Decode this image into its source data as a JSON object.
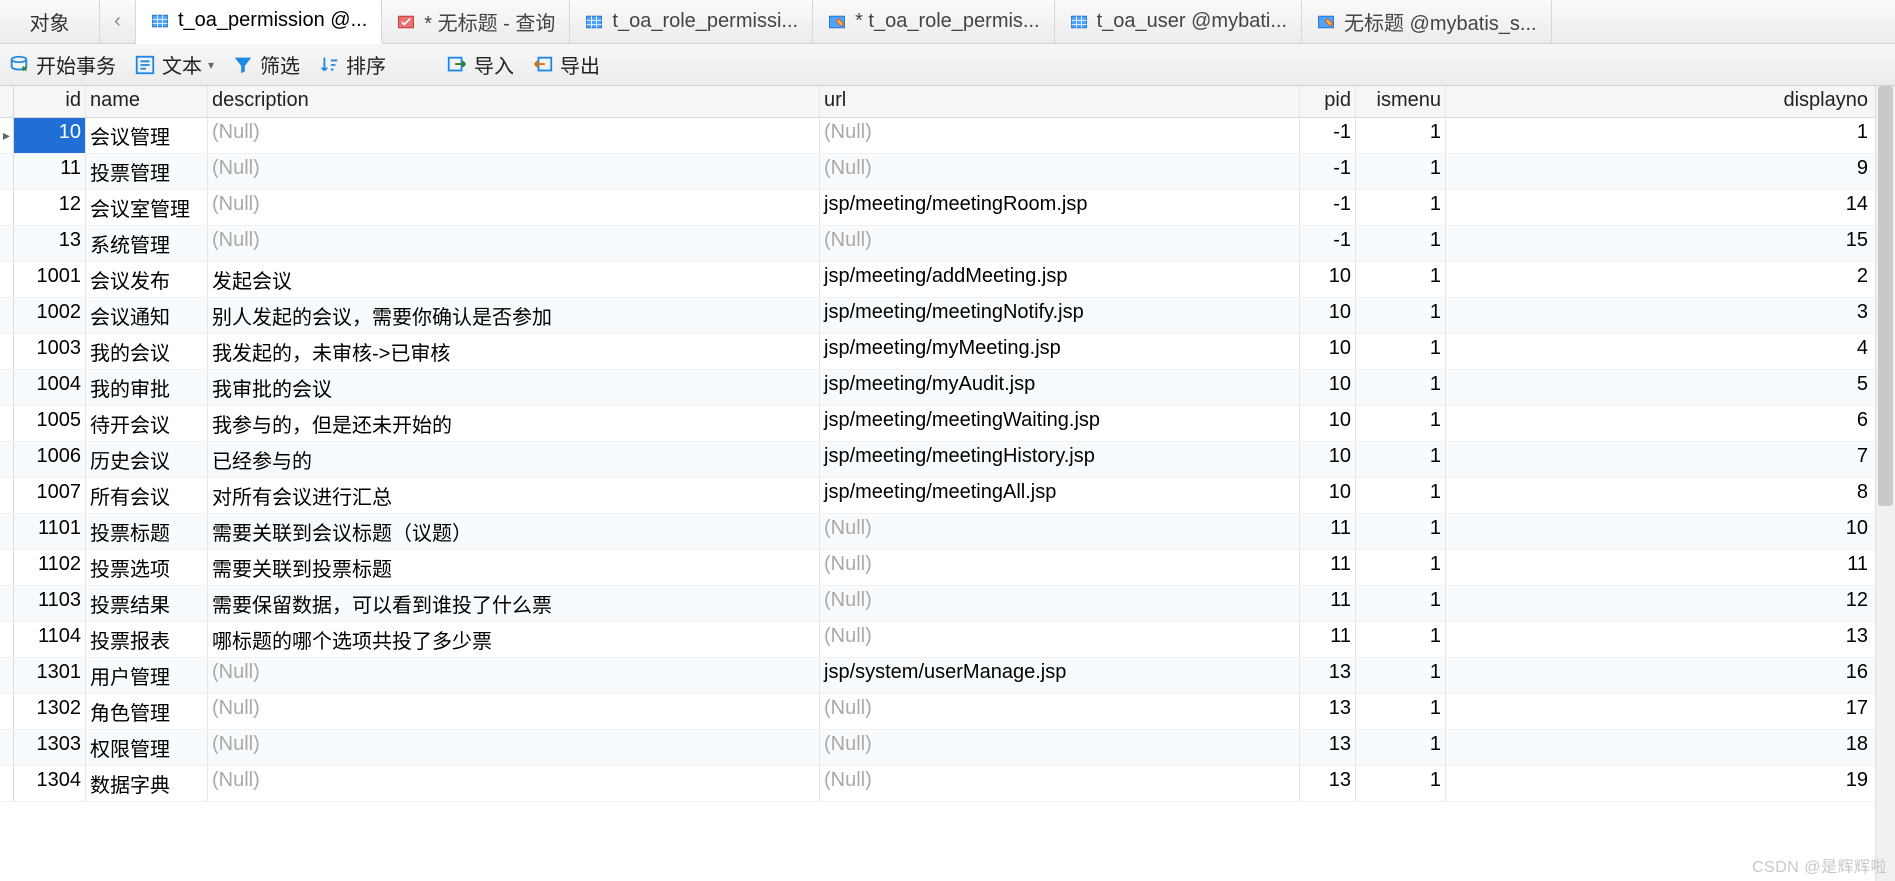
{
  "tabbar": {
    "object_label": "对象",
    "nav_prev": "‹",
    "tabs": [
      {
        "label": "t_oa_permission @...",
        "icon": "table",
        "active": true
      },
      {
        "label": "* 无标题 - 查询",
        "icon": "query",
        "active": false
      },
      {
        "label": "t_oa_role_permissi...",
        "icon": "table",
        "active": false
      },
      {
        "label": "* t_oa_role_permis...",
        "icon": "design",
        "active": false
      },
      {
        "label": "t_oa_user @mybati...",
        "icon": "table",
        "active": false
      },
      {
        "label": "无标题 @mybatis_s...",
        "icon": "design",
        "active": false
      }
    ]
  },
  "toolbar": {
    "begin_tx": "开始事务",
    "text": "文本",
    "filter": "筛选",
    "sort": "排序",
    "import": "导入",
    "export": "导出"
  },
  "columns": {
    "id": "id",
    "name": "name",
    "description": "description",
    "url": "url",
    "pid": "pid",
    "ismenu": "ismenu",
    "displayno": "displayno"
  },
  "null_label": "(Null)",
  "rows": [
    {
      "id": 10,
      "name": "会议管理",
      "description": null,
      "url": null,
      "pid": -1,
      "ismenu": 1,
      "displayno": 1,
      "selected": true
    },
    {
      "id": 11,
      "name": "投票管理",
      "description": null,
      "url": null,
      "pid": -1,
      "ismenu": 1,
      "displayno": 9
    },
    {
      "id": 12,
      "name": "会议室管理",
      "description": null,
      "url": "jsp/meeting/meetingRoom.jsp",
      "pid": -1,
      "ismenu": 1,
      "displayno": 14
    },
    {
      "id": 13,
      "name": "系统管理",
      "description": null,
      "url": null,
      "pid": -1,
      "ismenu": 1,
      "displayno": 15
    },
    {
      "id": 1001,
      "name": "会议发布",
      "description": "发起会议",
      "url": "jsp/meeting/addMeeting.jsp",
      "pid": 10,
      "ismenu": 1,
      "displayno": 2
    },
    {
      "id": 1002,
      "name": "会议通知",
      "description": "别人发起的会议，需要你确认是否参加",
      "url": "jsp/meeting/meetingNotify.jsp",
      "pid": 10,
      "ismenu": 1,
      "displayno": 3
    },
    {
      "id": 1003,
      "name": "我的会议",
      "description": "我发起的，未审核->已审核",
      "url": "jsp/meeting/myMeeting.jsp",
      "pid": 10,
      "ismenu": 1,
      "displayno": 4
    },
    {
      "id": 1004,
      "name": "我的审批",
      "description": "我审批的会议",
      "url": "jsp/meeting/myAudit.jsp",
      "pid": 10,
      "ismenu": 1,
      "displayno": 5
    },
    {
      "id": 1005,
      "name": "待开会议",
      "description": "我参与的，但是还未开始的",
      "url": "jsp/meeting/meetingWaiting.jsp",
      "pid": 10,
      "ismenu": 1,
      "displayno": 6
    },
    {
      "id": 1006,
      "name": "历史会议",
      "description": "已经参与的",
      "url": "jsp/meeting/meetingHistory.jsp",
      "pid": 10,
      "ismenu": 1,
      "displayno": 7
    },
    {
      "id": 1007,
      "name": "所有会议",
      "description": "对所有会议进行汇总",
      "url": "jsp/meeting/meetingAll.jsp",
      "pid": 10,
      "ismenu": 1,
      "displayno": 8
    },
    {
      "id": 1101,
      "name": "投票标题",
      "description": "需要关联到会议标题（议题）",
      "url": null,
      "pid": 11,
      "ismenu": 1,
      "displayno": 10
    },
    {
      "id": 1102,
      "name": "投票选项",
      "description": "需要关联到投票标题",
      "url": null,
      "pid": 11,
      "ismenu": 1,
      "displayno": 11
    },
    {
      "id": 1103,
      "name": "投票结果",
      "description": "需要保留数据，可以看到谁投了什么票",
      "url": null,
      "pid": 11,
      "ismenu": 1,
      "displayno": 12
    },
    {
      "id": 1104,
      "name": "投票报表",
      "description": "哪标题的哪个选项共投了多少票",
      "url": null,
      "pid": 11,
      "ismenu": 1,
      "displayno": 13
    },
    {
      "id": 1301,
      "name": "用户管理",
      "description": null,
      "url": "jsp/system/userManage.jsp",
      "pid": 13,
      "ismenu": 1,
      "displayno": 16
    },
    {
      "id": 1302,
      "name": "角色管理",
      "description": null,
      "url": null,
      "pid": 13,
      "ismenu": 1,
      "displayno": 17
    },
    {
      "id": 1303,
      "name": "权限管理",
      "description": null,
      "url": null,
      "pid": 13,
      "ismenu": 1,
      "displayno": 18
    },
    {
      "id": 1304,
      "name": "数据字典",
      "description": null,
      "url": null,
      "pid": 13,
      "ismenu": 1,
      "displayno": 19
    }
  ],
  "watermark": "CSDN @是辉辉啦"
}
